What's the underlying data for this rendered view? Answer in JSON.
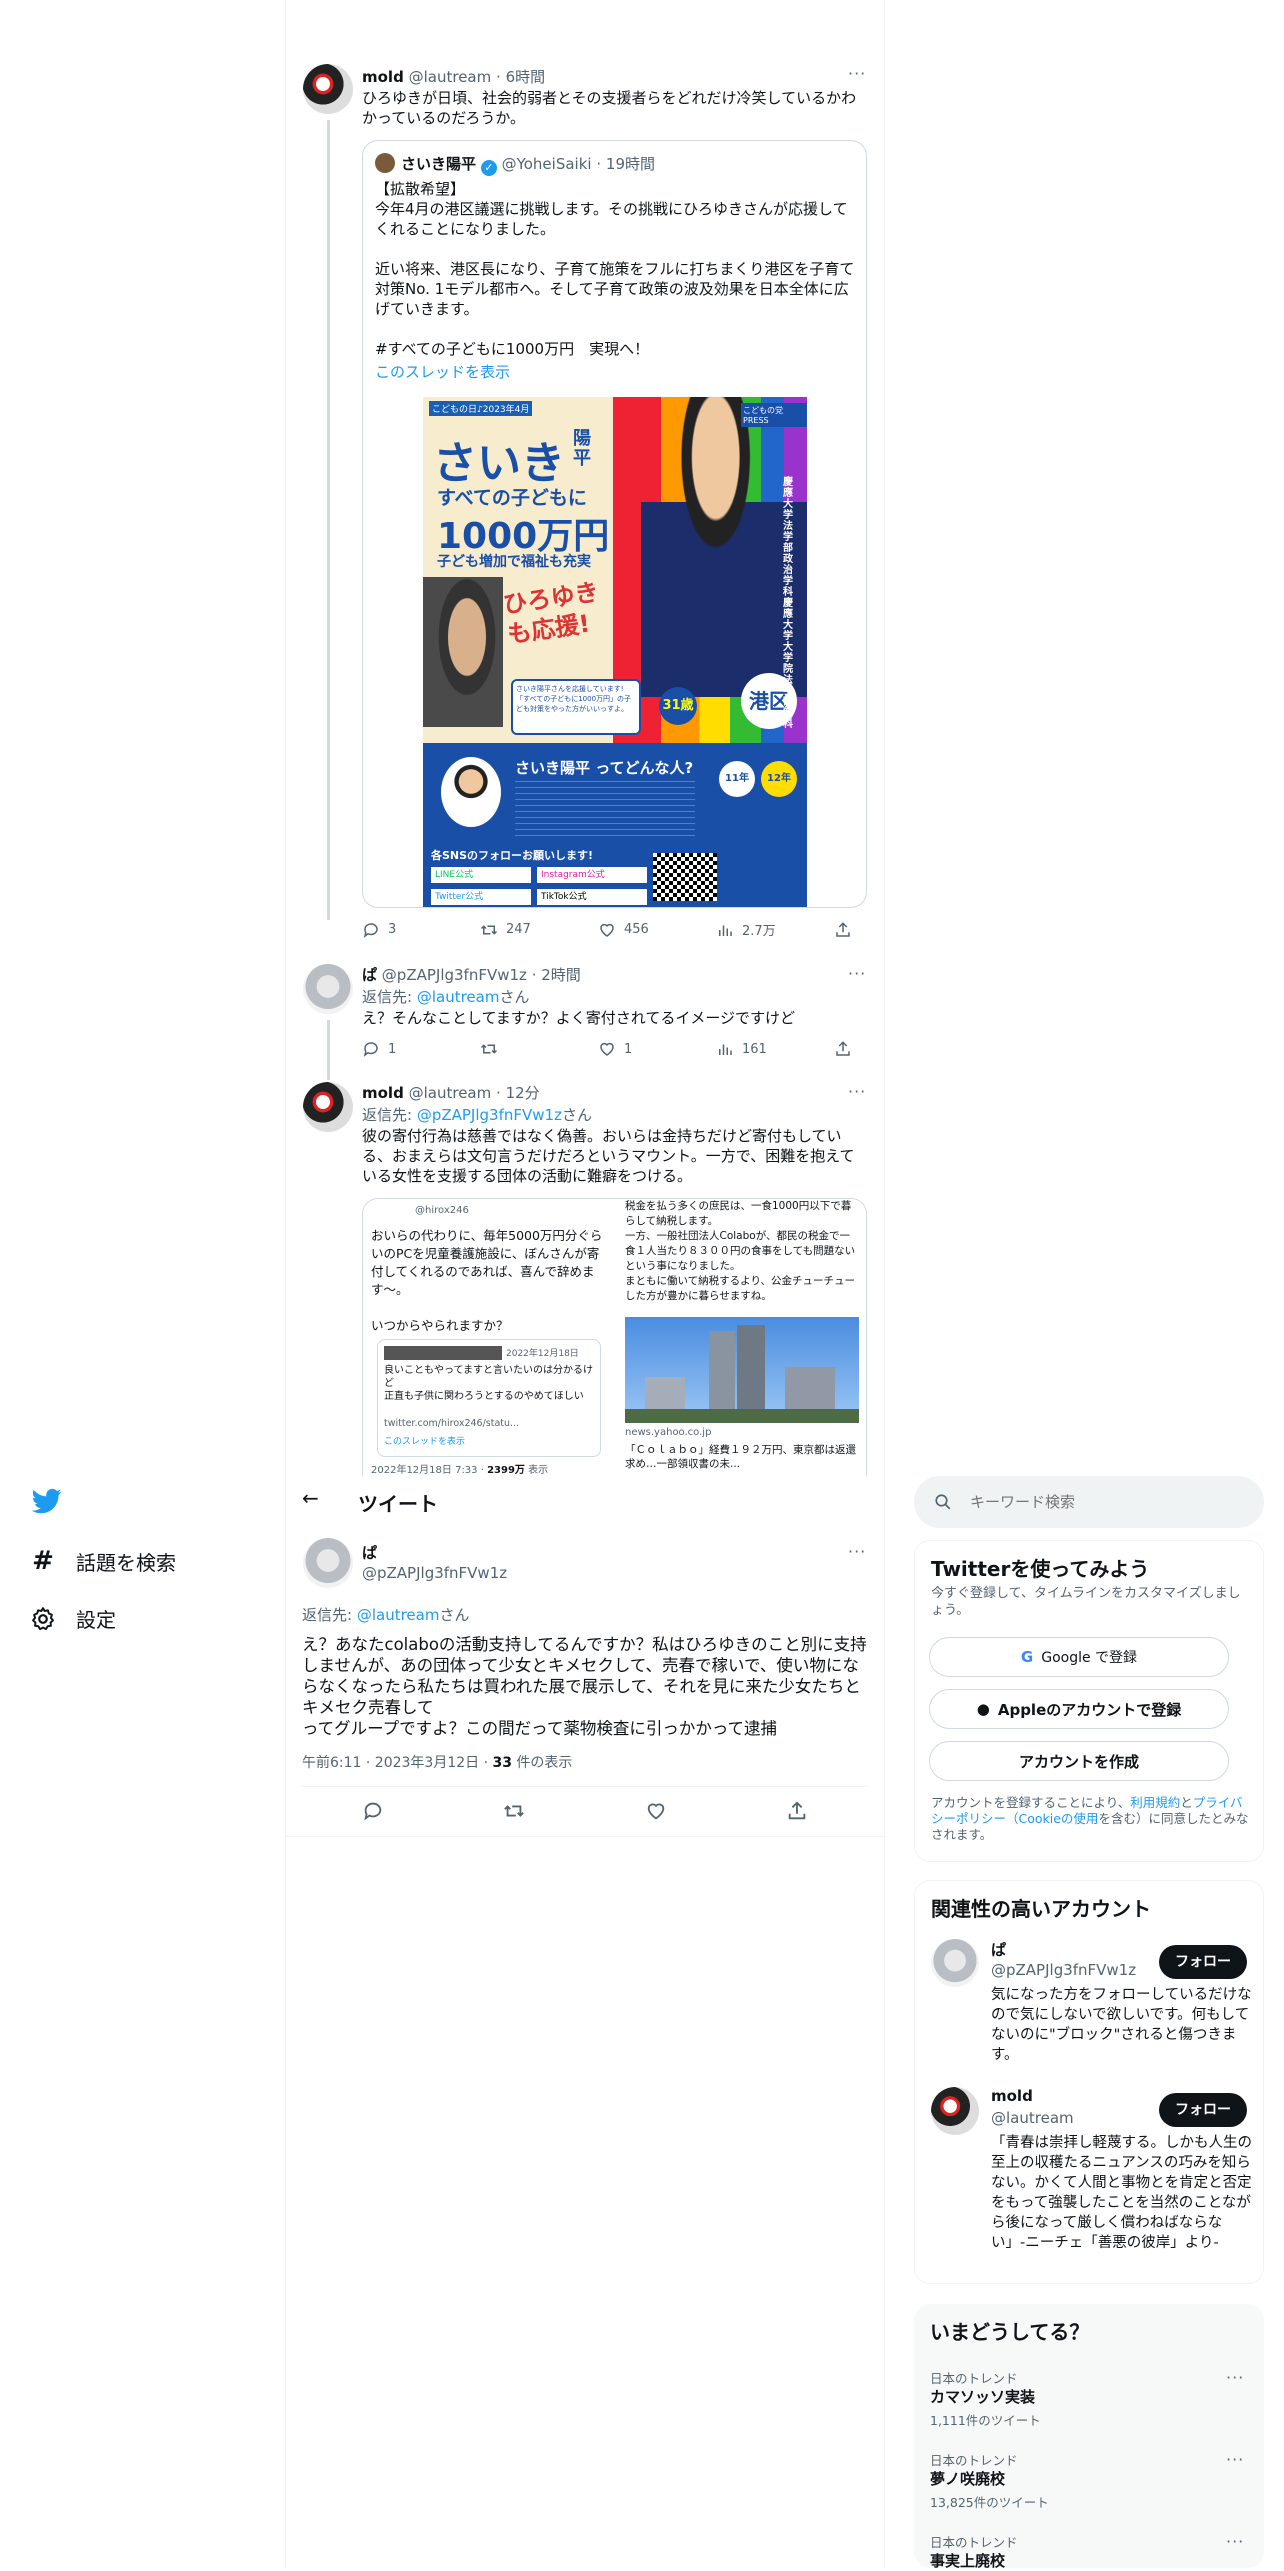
{
  "left_nav": {
    "items": [
      {
        "label": "話題を検索",
        "icon": "hashtag-icon"
      },
      {
        "label": "設定",
        "icon": "gear-icon"
      }
    ]
  },
  "thread": {
    "tweet1": {
      "name": "mold",
      "handle": "@lautream",
      "time": "6時間",
      "text": "ひろゆきが日頃、社会的弱者とその支援者らをどれだけ冷笑しているかわかっているのだろうか。",
      "quote": {
        "name": "さいき陽平",
        "handle": "@YoheiSaiki",
        "time": "19時間",
        "text": "【拡散希望】\n今年4月の港区議選に挑戦します。その挑戦にひろゆきさんが応援してくれることになりました。\n\n近い将来、港区長になり、子育て施策をフルに打ちまくり港区を子育て対策No. 1モデル都市へ。そして子育て政策の波及効果を日本全体に広げていきます。\n\n#すべての子どもに1000万円　実現へ！",
        "show_thread": "このスレッドを表示",
        "flyer": {
          "top_small": "こどもの日♪2023年4月",
          "name_big": "さいき",
          "name_side": "陽平",
          "headline1": "すべての子どもに",
          "headline2": "1000万円",
          "headline3": "子ども増加で福祉も充実",
          "support": "ひろゆきも応援!",
          "badge_age": "31歳",
          "badge_area": "港区",
          "bubble": "さいき陽平さんを応援しています! 「すべての子どもに1000万円」の子ども対策をやった方がいいっすよ。",
          "press": "こどもの党 PRESS",
          "vertical": "慶應大学法学部政治学科 慶應大学大学院法学研究科",
          "bottom_title": "さいき陽平 ってどんな人?",
          "years1": "11年",
          "years2": "12年",
          "sns": "各SNSのフォローお願いします!",
          "line": "LINE公式",
          "insta": "Instagram公式",
          "twitter": "Twitter公式",
          "tiktok": "TikTok公式"
        }
      },
      "stats": {
        "replies": "3",
        "retweets": "247",
        "likes": "456",
        "views": "2.7万"
      }
    },
    "tweet2": {
      "name": "ぱ",
      "handle": "@pZAPJlg3fnFVw1z",
      "time": "2時間",
      "reply_prefix": "返信先: ",
      "reply_to": "@lautream",
      "reply_suffix": "さん",
      "text": "え？そんなことしてますか？よく寄付されてるイメージですけど",
      "stats": {
        "replies": "1",
        "retweets": "",
        "likes": "1",
        "views": "161"
      }
    },
    "tweet3": {
      "name": "mold",
      "handle": "@lautream",
      "time": "12分",
      "reply_prefix": "返信先: ",
      "reply_to": "@pZAPJlg3fnFVw1z",
      "reply_suffix": "さん",
      "text": "彼の寄付行為は慈善ではなく偽善。おいらは金持ちだけど寄付もしている、おまえらは文句言うだけだろというマウント。一方で、困難を抱えている女性を支援する団体の活動に難癖をつける。",
      "img_left": {
        "handle": "@hirox246",
        "text": "おいらの代わりに、毎年5000万円分ぐらいのPCを児童養護施設に、ぼんさんが寄付してくれるのであれば、喜んで辞めます〜。\n\nいつからやられますか？",
        "inner_date": "2022年12月18日",
        "inner_text": "良いこともやってますと言いたいのは分かるけど\n正直も子供に関わろうとするのやめてほしい",
        "inner_link": "twitter.com/hirox246/statu...",
        "inner_thread": "このスレッドを表示",
        "footer": "2022年12月18日 7:33 · ",
        "footer_views": "2399万",
        "footer_suffix": " 表示"
      },
      "img_right": {
        "text": "税金を払う多くの庶民は、一食1000円以下で暮らして納税します。\n一方、一般社団法人Colaboが、都民の税金で一食１人当たり８３００円の食事をしても問題ないという事になりました。\nまともに働いて納税するより、公金チューチューした方が豊かに暮らせますね。",
        "source": "news.yahoo.co.jp",
        "headline": "「Ｃｏｌａｂｏ」経費１９２万円、東京都は返還求め…一部領収書の未..."
      }
    }
  },
  "header": {
    "title": "ツイート",
    "back": "←"
  },
  "main_tweet": {
    "name": "ぱ",
    "handle": "@pZAPJlg3fnFVw1z",
    "reply_prefix": "返信先: ",
    "reply_to": "@lautream",
    "reply_suffix": "さん",
    "text": "え？あなたcolaboの活動支持してるんですか？私はひろゆきのこと別に支持しませんが、あの団体って少女とキメセクして、売春で稼いで、使い物にならなくなったら私たちは買われた展で展示して、それを見に来た少女たちとキメセク売春して\nってグループですよ？この間だって薬物検査に引っかかって逮捕",
    "time": "午前6:11 · 2023年3月12日 · ",
    "views_num": "33",
    "views_label": " 件の表示"
  },
  "search": {
    "placeholder": "キーワード検索"
  },
  "signup": {
    "title": "Twitterを使ってみよう",
    "subtitle": "今すぐ登録して、タイムラインをカスタマイズしましょう。",
    "google": "Google で登録",
    "apple": "Appleのアカウントで登録",
    "create": "アカウントを作成",
    "legal_pre": "アカウントを登録することにより、",
    "legal_terms": "利用規約",
    "legal_mid": "と",
    "legal_privacy": "プライバシーポリシー（Cookieの使用",
    "legal_post": "を含む）に同意したとみなされます。"
  },
  "related": {
    "title": "関連性の高いアカウント",
    "follow_label": "フォロー",
    "accounts": [
      {
        "name": "ぱ",
        "handle": "@pZAPJlg3fnFVw1z",
        "bio": "気になった方をフォローしているだけなので気にしないで欲しいです。何もしてないのに\"ブロック\"されると傷つきます。"
      },
      {
        "name": "mold",
        "handle": "@lautream",
        "bio": "「青春は崇拝し軽蔑する。しかも人生の至上の収穫たるニュアンスの巧みを知らない。かくて人間と事物とを肯定と否定をもって強襲したことを当然のことながら後になって厳しく償わねばならない」-ニーチェ「善悪の彼岸」より-"
      }
    ]
  },
  "trends": {
    "title": "いまどうしてる？",
    "items": [
      {
        "category": "日本のトレンド",
        "name": "カマソッソ実装",
        "count": "1,111件のツイート"
      },
      {
        "category": "日本のトレンド",
        "name": "夢ノ咲廃校",
        "count": "13,825件のツイート"
      },
      {
        "category": "日本のトレンド",
        "name": "事実上廃校",
        "count": ""
      }
    ]
  },
  "colors": {
    "accent": "#1d9bf0",
    "text": "#0f1419",
    "secondary": "#536471",
    "border": "#cfd9de"
  }
}
